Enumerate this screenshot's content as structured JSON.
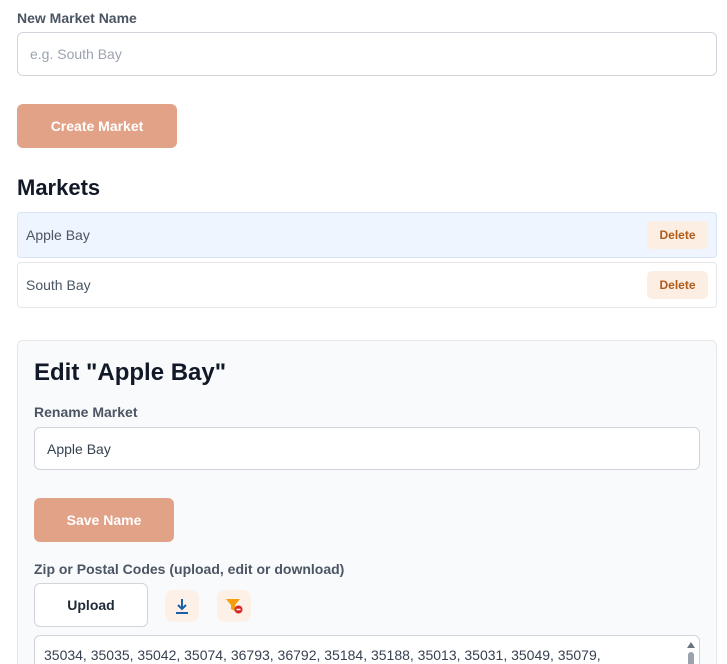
{
  "new_market": {
    "label": "New Market Name",
    "placeholder": "e.g. South Bay",
    "create_button": "Create Market"
  },
  "markets": {
    "heading": "Markets",
    "delete_label": "Delete",
    "items": [
      {
        "name": "Apple Bay",
        "selected": true
      },
      {
        "name": "South Bay",
        "selected": false
      }
    ]
  },
  "edit": {
    "heading": "Edit \"Apple Bay\"",
    "rename_label": "Rename Market",
    "rename_value": "Apple Bay",
    "save_button": "Save Name",
    "codes_label": "Zip or Postal Codes (upload, edit or download)",
    "upload_button": "Upload",
    "download_icon": "download-icon",
    "clear_filter_icon": "filter-remove-icon",
    "codes_value": "35034, 35035, 35042, 35074, 36793, 36792, 35184, 35188, 35013, 35031, 35049, 35079,"
  },
  "colors": {
    "primary": "#e2a287",
    "delete_bg": "#fdeee3",
    "delete_text": "#b15a17",
    "selected_row": "#eef5ff"
  }
}
